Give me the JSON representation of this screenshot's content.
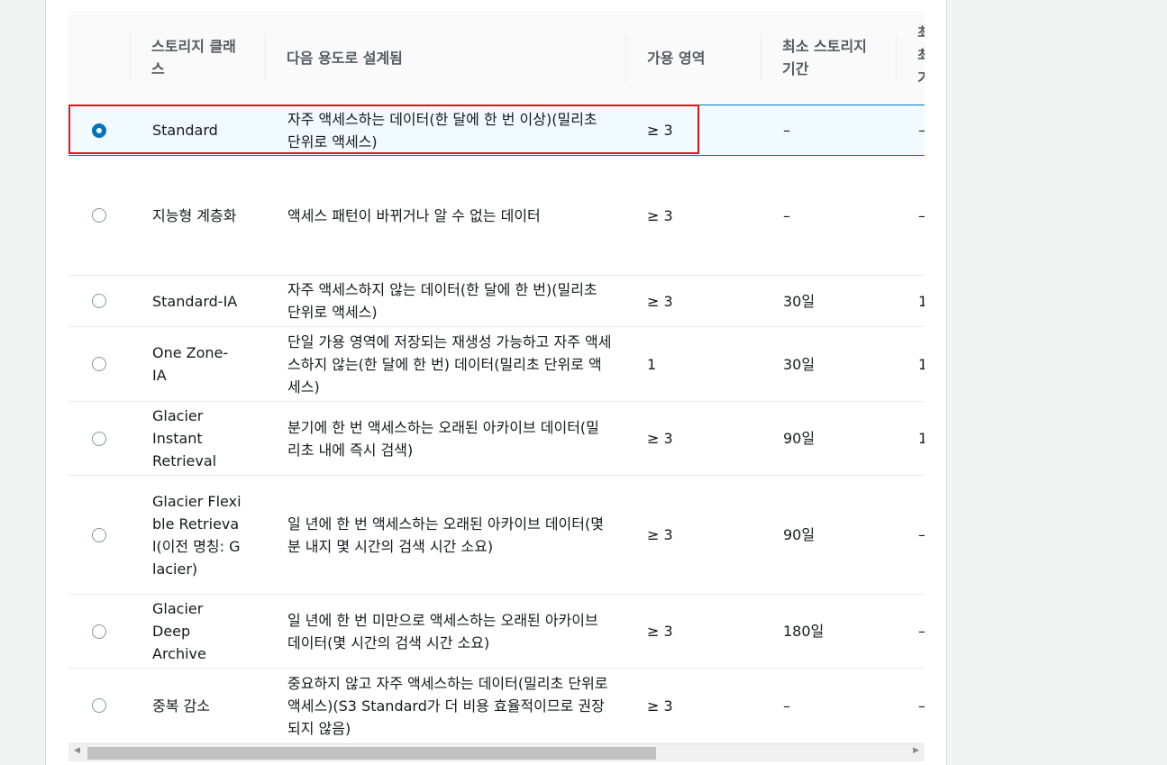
{
  "table": {
    "headers": {
      "storage_class": "스토리지 클래스",
      "designed_for": "다음 용도로 설계됨",
      "availability_zones": "가용 영역",
      "min_storage_duration": "최소 스토리지 기간",
      "next_col_partial": "최 최 기"
    },
    "rows": [
      {
        "name": "Standard",
        "designed_for": "자주 액세스하는 데이터(한 달에 한 번 이상)(밀리초 단위로 액세스)",
        "az": "≥ 3",
        "min_duration": "–",
        "next": "–",
        "selected": true
      },
      {
        "name": "지능형 계층화",
        "designed_for": "액세스 패턴이 바뀌거나 알 수 없는 데이터",
        "az": "≥ 3",
        "min_duration": "–",
        "next": "–",
        "selected": false
      },
      {
        "name": "Standard-IA",
        "designed_for": "자주 액세스하지 않는 데이터(한 달에 한 번)(밀리초 단위로 액세스)",
        "az": "≥ 3",
        "min_duration": "30일",
        "next": "1",
        "selected": false
      },
      {
        "name": "One Zone-IA",
        "designed_for": "단일 가용 영역에 저장되는 재생성 가능하고 자주 액세스하지 않는(한 달에 한 번) 데이터(밀리초 단위로 액세스)",
        "az": "1",
        "min_duration": "30일",
        "next": "1",
        "selected": false
      },
      {
        "name": "Glacier Instant Retrieval",
        "designed_for": "분기에 한 번 액세스하는 오래된 아카이브 데이터(밀리초 내에 즉시 검색)",
        "az": "≥ 3",
        "min_duration": "90일",
        "next": "1",
        "selected": false
      },
      {
        "name": "Glacier Flexible Retrieval(이전 명칭: Glacier)",
        "designed_for": "일 년에 한 번 액세스하는 오래된 아카이브 데이터(몇 분 내지 몇 시간의 검색 시간 소요)",
        "az": "≥ 3",
        "min_duration": "90일",
        "next": "–",
        "selected": false
      },
      {
        "name": "Glacier Deep Archive",
        "designed_for": "일 년에 한 번 미만으로 액세스하는 오래된 아카이브 데이터(몇 시간의 검색 시간 소요)",
        "az": "≥ 3",
        "min_duration": "180일",
        "next": "–",
        "selected": false
      },
      {
        "name": "중복 감소",
        "designed_for": "중요하지 않고 자주 액세스하는 데이터(밀리초 단위로 액세스)(S3 Standard가 더 비용 효율적이므로 권장되지 않음)",
        "az": "≥ 3",
        "min_duration": "–",
        "next": "–",
        "selected": false
      }
    ]
  },
  "scrollbar": {
    "left_arrow": "◀",
    "right_arrow": "▶"
  }
}
